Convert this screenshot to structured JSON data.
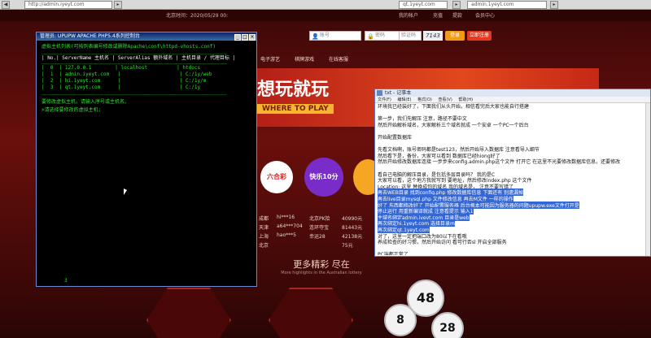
{
  "browser": {
    "tab1_address": "http://admin.iyeyt.com",
    "tab2_address": "qt.1yeyt.com",
    "tab3_address": "admin.1yeyt.com"
  },
  "site": {
    "topbar": {
      "datetime": "北京时间：2020/05/29 00:",
      "links": [
        "我的帐户",
        "充值",
        "提款",
        "会员中心"
      ]
    },
    "login": {
      "account_placeholder": "账号",
      "password_placeholder": "密码",
      "captcha_placeholder": "验证码",
      "captcha_code": "7143",
      "login_button": "登录",
      "register_button": "立即注册"
    },
    "nav": [
      "电子游艺",
      "棋牌游戏",
      "在线客服"
    ],
    "banner": {
      "slogan": "想玩就玩",
      "where": "WHERE TO PLAY"
    },
    "lottery_balls": [
      "六合彩",
      "快乐10分"
    ],
    "results": [
      {
        "city": "成都",
        "user": "hi***16",
        "game": "北京PK拾",
        "amount": "40990元"
      },
      {
        "city": "天津",
        "user": "a64***704",
        "game": "连环夺宝",
        "amount": "81443元"
      },
      {
        "city": "上海",
        "user": "hao***5",
        "game": "幸运28",
        "amount": "42138元"
      },
      {
        "city": "北京",
        "user": "",
        "game": "",
        "amount": "75元"
      }
    ],
    "more": {
      "title": "更多精彩 尽在",
      "subtitle": "More highlights in the Australian lottery"
    }
  },
  "cmd": {
    "title": "管理员:  UPUPW APACHE PHP5.4系列控制台",
    "subtitle": "虚拟主机列表(可按列表编号修改或删除Apache\\conf\\httpd-vhosts.conf)",
    "header": "| No.| ServerName 主机名 | ServerAlias 额外域名 | 主机目录 / 代理目标 |",
    "rows": [
      "|  0  | 127.0.0.1        | localhost          | htdocs",
      "|  1  | admin.iyeyt.com   |                    | C:/1y/web",
      "|  2  | hi.1yeyt.com      |                    | C:/1y/m",
      "|  3  | qt.1yeyt.com      |                    | C:/1y"
    ],
    "prompt1": "要修改虚拟主机，请输入序号或主机名。",
    "prompt2": ">请选择要修改的虚拟主机:",
    "bottom": "3"
  },
  "notepad": {
    "title": "txt - 记事本",
    "menu": [
      "文件(F)",
      "编辑(E)",
      "格式(O)",
      "查看(V)",
      "帮助(H)"
    ],
    "lines": [
      "环境我已经装好了，下面我们从头开始，相信看完后大家也能自行搭建",
      "",
      "第一步，我们先解压   注意，路径不要中文",
      "然后开始解析域名，大家解析三个域名就成     一个安卓  一个PC一个后台",
      "",
      "开始配置数据库",
      "",
      "先看文档啊，账号密码都是test123，然后开始导入数据库  注意看导入细节",
      "然后看下是，备份，大家可以看到 数据库已经hiong好了",
      "然后开始修改数据库连接   一步步来config.admin.php这个文件  打开它 在这里不光要修改数据库信息，还要修改",
      "",
      "看自己电脑的解压目录，是包括多层目录吗？ 我的是C",
      "大家可以看，这个地方我就写到  要地址，然后修改index.php 这个文件",
      "Location:  这里 替换成你的域名  我的域名是，  注意不要写错了",
      "再去WEB目录  找到config.php  修改数据库信息  下面还有 别遗漏掉",
      "再去live目录mysql.php  文件修改信息   再去M文件  一样的操作",
      "好了  东西都修改好了  开始配置服务器  后台根本可能因为服务器的问题upupw.exe文件打开是",
      "停止运行       用重新编译就成    注意看提示  输入1",
      "主域名绑定admin.iyeyt.com    目录是web",
      "再次绑定hi.1yeyt.com    选择目录m",
      "再次绑定qt.1yeyt.com",
      "对了，这里一定把端口改为80以下在看哦",
      "养成检查的好习惯，然后开始访问  看可行否sl  开启全部服务",
      "",
      "PC端都正常了"
    ],
    "selected_start": 14,
    "selected_end": 20
  }
}
